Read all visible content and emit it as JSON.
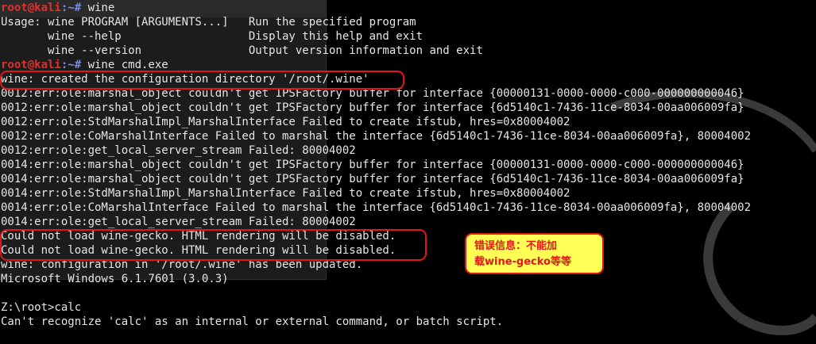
{
  "terminal": {
    "prompt": {
      "user": "root@kali",
      "path": ":~# "
    },
    "lines": [
      {
        "type": "prompt",
        "command": "wine"
      },
      {
        "type": "out",
        "text": "Usage: wine PROGRAM [ARGUMENTS...]   Run the specified program"
      },
      {
        "type": "out",
        "text": "       wine --help                   Display this help and exit"
      },
      {
        "type": "out",
        "text": "       wine --version                Output version information and exit"
      },
      {
        "type": "prompt",
        "command": "wine cmd.exe"
      },
      {
        "type": "out",
        "text": "wine: created the configuration directory '/root/.wine'"
      },
      {
        "type": "out",
        "text": "0012:err:ole:marshal_object couldn't get IPSFactory buffer for interface {00000131-0000-0000-c000-000000000046}"
      },
      {
        "type": "out",
        "text": "0012:err:ole:marshal_object couldn't get IPSFactory buffer for interface {6d5140c1-7436-11ce-8034-00aa006009fa}"
      },
      {
        "type": "out",
        "text": "0012:err:ole:StdMarshalImpl_MarshalInterface Failed to create ifstub, hres=0x80004002"
      },
      {
        "type": "out",
        "text": "0012:err:ole:CoMarshalInterface Failed to marshal the interface {6d5140c1-7436-11ce-8034-00aa006009fa}, 80004002"
      },
      {
        "type": "out",
        "text": "0012:err:ole:get_local_server_stream Failed: 80004002"
      },
      {
        "type": "out",
        "text": "0014:err:ole:marshal_object couldn't get IPSFactory buffer for interface {00000131-0000-0000-c000-000000000046}"
      },
      {
        "type": "out",
        "text": "0014:err:ole:marshal_object couldn't get IPSFactory buffer for interface {6d5140c1-7436-11ce-8034-00aa006009fa}"
      },
      {
        "type": "out",
        "text": "0014:err:ole:StdMarshalImpl_MarshalInterface Failed to create ifstub, hres=0x80004002"
      },
      {
        "type": "out",
        "text": "0014:err:ole:CoMarshalInterface Failed to marshal the interface {6d5140c1-7436-11ce-8034-00aa006009fa}, 80004002"
      },
      {
        "type": "out",
        "text": "0014:err:ole:get_local_server_stream Failed: 80004002"
      },
      {
        "type": "out",
        "text": "Could not load wine-gecko. HTML rendering will be disabled."
      },
      {
        "type": "out",
        "text": "Could not load wine-gecko. HTML rendering will be disabled."
      },
      {
        "type": "out",
        "text": "wine: configuration in '/root/.wine' has been updated."
      },
      {
        "type": "out",
        "text": "Microsoft Windows 6.1.7601 (3.0.3)"
      },
      {
        "type": "out",
        "text": ""
      },
      {
        "type": "out",
        "text": "Z:\\root>calc"
      },
      {
        "type": "out",
        "text": "Can't recognize 'calc' as an internal or external command, or batch script."
      }
    ]
  },
  "callout": {
    "line1": "错误信息：不能加",
    "line2": "载wine-gecko等等"
  },
  "colors": {
    "background": "#000000",
    "text": "#e6e6e6",
    "prompt_user": "#e0302c",
    "prompt_path": "#7a8ce0",
    "annotation_red": "#e31515",
    "callout_yellow": "#ffff55"
  }
}
